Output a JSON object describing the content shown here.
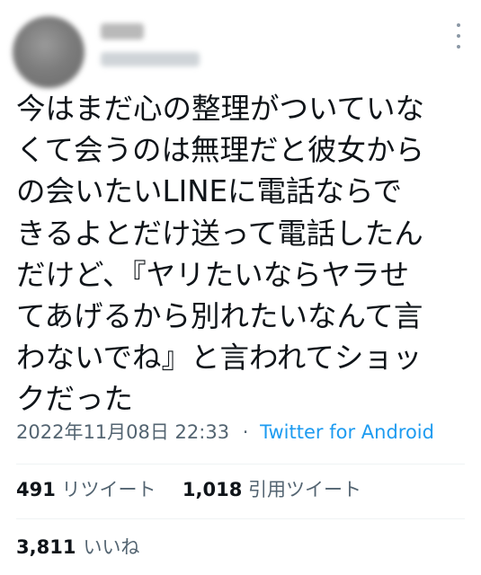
{
  "tweet": {
    "lines": [
      "今はまだ心の整理がついていな",
      "くて会うのは無理だと彼女から",
      "の会いたいLINEに電話ならで",
      "きるよとだけ送って電話したん",
      "だけど、『ヤリたいならヤラせ",
      "てあげるから別れたいなんて言",
      "わないでね』と言われてショッ",
      "クだった"
    ]
  },
  "meta": {
    "datetime": "2022年11月08日 22:33",
    "separator": "·",
    "source": "Twitter for Android"
  },
  "stats": {
    "retweets_count": "491",
    "retweets_label": "リツイート",
    "quotes_count": "1,018",
    "quotes_label": "引用ツイート",
    "likes_count": "3,811",
    "likes_label": "いいね"
  },
  "icons": {
    "more": "more-vertical-icon"
  },
  "colors": {
    "text": "#0f1419",
    "secondary": "#536471",
    "link": "#1d9bf0",
    "divider": "#eff3f4"
  }
}
